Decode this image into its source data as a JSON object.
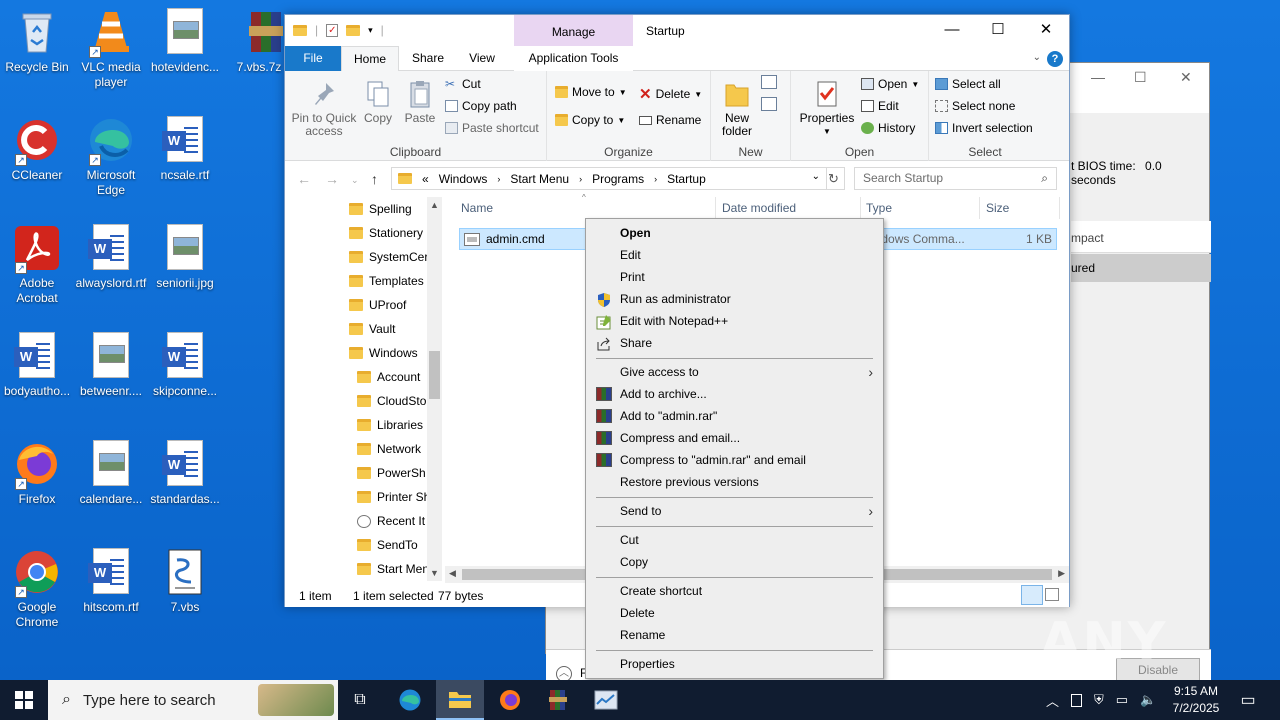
{
  "desktop": {
    "icons": [
      {
        "label": "Recycle Bin"
      },
      {
        "label": "VLC media player"
      },
      {
        "label": "hotevidenc..."
      },
      {
        "label": "7.vbs.7z"
      },
      {
        "label": "CCleaner"
      },
      {
        "label": "Microsoft Edge"
      },
      {
        "label": "ncsale.rtf"
      },
      {
        "label": "Adobe Acrobat"
      },
      {
        "label": "alwayslord.rtf"
      },
      {
        "label": "seniorii.jpg"
      },
      {
        "label": "bodyautho..."
      },
      {
        "label": "betweenr...."
      },
      {
        "label": "skipconne..."
      },
      {
        "label": "Firefox"
      },
      {
        "label": "calendare..."
      },
      {
        "label": "standardas..."
      },
      {
        "label": "Google Chrome"
      },
      {
        "label": "hitscom.rtf"
      },
      {
        "label": "7.vbs"
      }
    ]
  },
  "background_window": {
    "bios_text": "t BIOS time:",
    "bios_value": "0.0 seconds",
    "row_header": "mpact",
    "row_value": "ured",
    "footer_left": "F",
    "disable_button": "Disable"
  },
  "explorer": {
    "title": "Startup",
    "manage_tab": "Manage",
    "tabs": {
      "file": "File",
      "home": "Home",
      "share": "Share",
      "view": "View",
      "app_tools": "Application Tools"
    },
    "help": "?",
    "ribbon": {
      "clipboard": {
        "label": "Clipboard",
        "pin": "Pin to Quick access",
        "copy": "Copy",
        "paste": "Paste",
        "cut": "Cut",
        "copy_path": "Copy path",
        "paste_shortcut": "Paste shortcut"
      },
      "organize": {
        "label": "Organize",
        "move_to": "Move to",
        "copy_to": "Copy to",
        "delete": "Delete",
        "rename": "Rename"
      },
      "new": {
        "label": "New",
        "new_folder": "New folder"
      },
      "open": {
        "label": "Open",
        "properties": "Properties",
        "open": "Open",
        "edit": "Edit",
        "history": "History"
      },
      "select": {
        "label": "Select",
        "select_all": "Select all",
        "select_none": "Select none",
        "invert": "Invert selection"
      }
    },
    "address": {
      "prefix": "«",
      "crumbs": [
        "Windows",
        "Start Menu",
        "Programs",
        "Startup"
      ],
      "search_placeholder": "Search Startup"
    },
    "nav_items": [
      "Spelling",
      "Stationery",
      "SystemCer",
      "Templates",
      "UProof",
      "Vault",
      "Windows",
      "Account",
      "CloudSto",
      "Libraries",
      "Network",
      "PowerSh",
      "Printer Sh",
      "Recent It",
      "SendTo",
      "Start Men"
    ],
    "columns": {
      "name": "Name",
      "date": "Date modified",
      "type": "Type",
      "size": "Size"
    },
    "file": {
      "name": "admin.cmd",
      "type": "indows Comma...",
      "size": "1 KB"
    },
    "status": {
      "count": "1 item",
      "selected": "1 item selected",
      "bytes": "77 bytes"
    }
  },
  "context_menu": {
    "items": [
      {
        "label": "Open",
        "icon": ""
      },
      {
        "label": "Edit",
        "icon": ""
      },
      {
        "label": "Print",
        "icon": ""
      },
      {
        "label": "Run as administrator",
        "icon": "shield-icon"
      },
      {
        "label": "Edit with Notepad++",
        "icon": "notepadpp-icon"
      },
      {
        "label": "Share",
        "icon": "share-icon"
      },
      {
        "label": "Give access to",
        "icon": ""
      },
      {
        "label": "Add to archive...",
        "icon": "winrar-icon"
      },
      {
        "label": "Add to \"admin.rar\"",
        "icon": "winrar-icon"
      },
      {
        "label": "Compress and email...",
        "icon": "winrar-icon"
      },
      {
        "label": "Compress to \"admin.rar\" and email",
        "icon": "winrar-icon"
      },
      {
        "label": "Restore previous versions",
        "icon": ""
      },
      {
        "label": "Send to",
        "icon": ""
      },
      {
        "label": "Cut",
        "icon": ""
      },
      {
        "label": "Copy",
        "icon": ""
      },
      {
        "label": "Create shortcut",
        "icon": ""
      },
      {
        "label": "Delete",
        "icon": ""
      },
      {
        "label": "Rename",
        "icon": ""
      },
      {
        "label": "Properties",
        "icon": ""
      }
    ]
  },
  "taskbar": {
    "search_placeholder": "Type here to search",
    "time": "9:15 AM",
    "date": "7/2/2025"
  },
  "watermark": "ANY RUN"
}
